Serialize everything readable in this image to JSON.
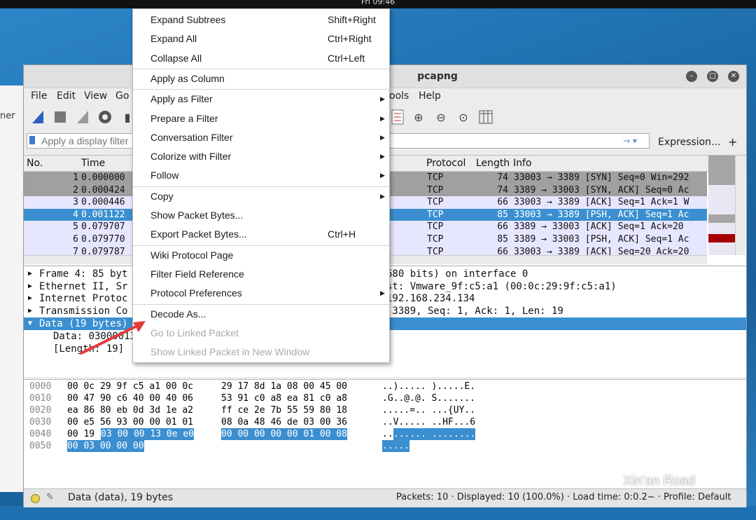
{
  "clock": "Fri 09:46",
  "background_window": {
    "label": "ner"
  },
  "window": {
    "title_visible": "pcapng"
  },
  "menubar": {
    "items": [
      {
        "id": "file",
        "label": "File"
      },
      {
        "id": "edit",
        "label": "Edit"
      },
      {
        "id": "view",
        "label": "View"
      },
      {
        "id": "go",
        "label": "Go"
      },
      {
        "id": "tools",
        "label": "ools"
      },
      {
        "id": "help",
        "label": "Help"
      }
    ]
  },
  "filter": {
    "placeholder": "Apply a display filter",
    "expression_label": "Expression...",
    "plus_label": "+"
  },
  "packet_list": {
    "headers": {
      "no": "No.",
      "time": "Time",
      "protocol": "Protocol",
      "length": "Length",
      "info": "Info"
    },
    "rows": [
      {
        "no": "1",
        "time": "0.000000",
        "protocol": "TCP",
        "length": "74",
        "info": "33003 → 3389 [SYN] Seq=0 Win=292"
      },
      {
        "no": "2",
        "time": "0.000424",
        "protocol": "TCP",
        "length": "74",
        "info": "3389 → 33003 [SYN, ACK] Seq=0 Ac"
      },
      {
        "no": "3",
        "time": "0.000446",
        "protocol": "TCP",
        "length": "66",
        "info": "33003 → 3389 [ACK] Seq=1 Ack=1 W"
      },
      {
        "no": "4",
        "time": "0.001122",
        "protocol": "TCP",
        "length": "85",
        "info": "33003 → 3389 [PSH, ACK] Seq=1 Ac"
      },
      {
        "no": "5",
        "time": "0.079707",
        "protocol": "TCP",
        "length": "66",
        "info": "3389 → 33003 [ACK] Seq=1 Ack=20"
      },
      {
        "no": "6",
        "time": "0.079770",
        "protocol": "TCP",
        "length": "85",
        "info": "3389 → 33003 [PSH, ACK] Seq=1 Ac"
      },
      {
        "no": "7",
        "time": "0.079787",
        "protocol": "TCP",
        "length": "66",
        "info": "33003 → 3389 [ACK] Seq=20 Ack=20"
      }
    ]
  },
  "details": {
    "rows": [
      {
        "left": "Frame 4: 85 byt",
        "right": "680 bits) on interface 0"
      },
      {
        "left": "Ethernet II, Sr",
        "right": "st: Vmware_9f:c5:a1 (00:0c:29:9f:c5:a1)"
      },
      {
        "left": "Internet Protoc",
        "right": "192.168.234.134"
      },
      {
        "left": "Transmission Co",
        "right": " 3389, Seq: 1, Ack: 1, Len: 19"
      },
      {
        "left": "Data (19 bytes)",
        "right": ""
      }
    ],
    "sub_rows": [
      "Data: 03000013",
      "[Length: 19]"
    ]
  },
  "bytes": {
    "rows": [
      {
        "offset": "0000",
        "hex1": "00 0c 29 9f c5 a1 00 0c",
        "hex2": "29 17 8d 1a 08 00 45 00",
        "ascii": "..)..... ).....E."
      },
      {
        "offset": "0010",
        "hex1": "00 47 90 c6 40 00 40 06",
        "hex2": "53 91 c0 a8 ea 81 c0 a8",
        "ascii": ".G..@.@. S......."
      },
      {
        "offset": "0020",
        "hex1": "ea 86 80 eb 0d 3d 1e a2",
        "hex2": "ff ce 2e 7b 55 59 80 18",
        "ascii": ".....=.. ...{UY.."
      },
      {
        "offset": "0030",
        "hex1": "00 e5 56 93 00 00 01 01",
        "hex2": "08 0a 48 46 de 03 00 36",
        "ascii": "..V..... ..HF...6"
      },
      {
        "offset": "0040",
        "hex1a": "00 19 ",
        "hex1b": "03 00 00 13 0e e0",
        "hex2": "00 00 00 00 00 01 00 08",
        "ascii_a": "..",
        "ascii_b": "...... ........"
      },
      {
        "offset": "0050",
        "hex_hl": "00 03 00 00 00",
        "ascii_hl": "....."
      }
    ]
  },
  "status": {
    "left": "Data (data), 19 bytes",
    "right": "Packets: 10 · Displayed: 10 (100.0%) · Load time: 0:0.2~ · Profile: Default"
  },
  "context_menu": {
    "items": [
      {
        "label": "Expand Subtrees",
        "shortcut": "Shift+Right"
      },
      {
        "label": "Expand All",
        "shortcut": "Ctrl+Right"
      },
      {
        "label": "Collapse All",
        "shortcut": "Ctrl+Left"
      },
      {
        "label": "Apply as Column",
        "shortcut": ""
      },
      {
        "label": "Apply as Filter",
        "shortcut": "",
        "submenu": "▶"
      },
      {
        "label": "Prepare a Filter",
        "shortcut": "",
        "submenu": "▶"
      },
      {
        "label": "Conversation Filter",
        "shortcut": "",
        "submenu": "▶"
      },
      {
        "label": "Colorize with Filter",
        "shortcut": "",
        "submenu": "▶"
      },
      {
        "label": "Follow",
        "shortcut": "",
        "submenu": "▶"
      },
      {
        "label": "Copy",
        "shortcut": "",
        "submenu": "▶"
      },
      {
        "label": "Show Packet Bytes...",
        "shortcut": ""
      },
      {
        "label": "Export Packet Bytes...",
        "shortcut": "Ctrl+H"
      },
      {
        "label": "Wiki Protocol Page",
        "shortcut": ""
      },
      {
        "label": "Filter Field Reference",
        "shortcut": ""
      },
      {
        "label": "Protocol Preferences",
        "shortcut": "",
        "submenu": "▶"
      },
      {
        "label": "Decode As...",
        "shortcut": ""
      },
      {
        "label": "Go to Linked Packet",
        "shortcut": "",
        "disabled": true
      },
      {
        "label": "Show Linked Packet in New Window",
        "shortcut": "",
        "disabled": true
      }
    ]
  },
  "watermark": "Xin'an Road",
  "colors": {
    "selection": "#3b8fd0",
    "row_gray": "#a0a0a0",
    "row_lavender": "#e7e6ff",
    "accent_red": "#e23b3b"
  }
}
